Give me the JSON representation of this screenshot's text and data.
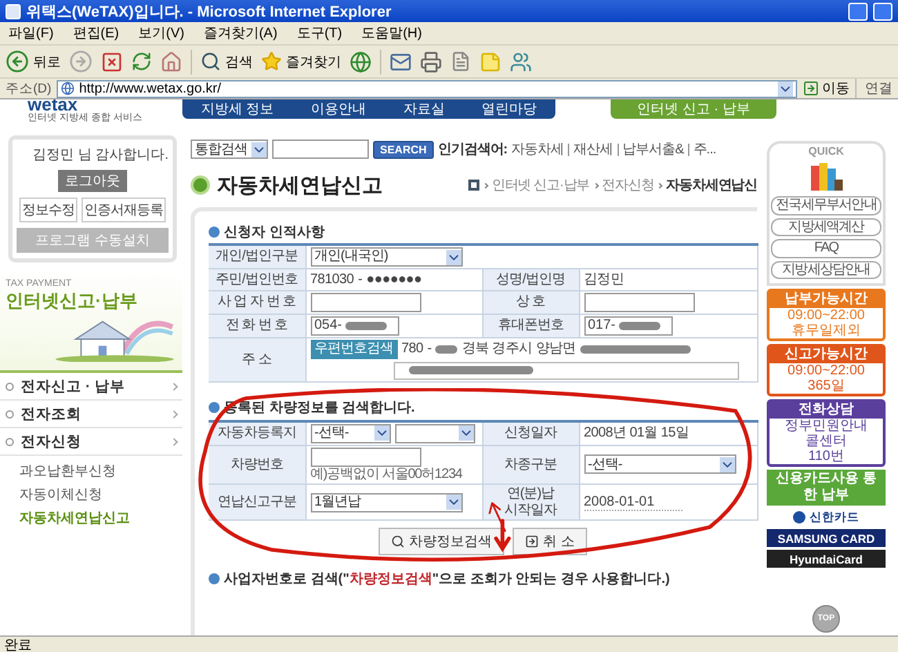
{
  "window": {
    "title": "위택스(WeTAX)입니다. - Microsoft Internet Explorer"
  },
  "menu": [
    "파일(F)",
    "편집(E)",
    "보기(V)",
    "즐겨찾기(A)",
    "도구(T)",
    "도움말(H)"
  ],
  "toolbar": {
    "back": "뒤로",
    "search": "검색",
    "favorites": "즐겨찾기"
  },
  "address_bar": {
    "label": "주소(D)",
    "url": "http://www.wetax.go.kr/",
    "go": "이동",
    "links": "연결"
  },
  "site_header": {
    "logo": "wetax",
    "tagline": "인터넷 지방세 종합 서비스",
    "nav": [
      {
        "label": "지방세 정보",
        "selected": false
      },
      {
        "label": "이용안내",
        "selected": false
      },
      {
        "label": "자료실",
        "selected": false
      },
      {
        "label": "열린마당",
        "selected": false
      },
      {
        "label": "인터넷 신고 · 납부",
        "selected": true
      }
    ]
  },
  "login": {
    "greeting": "김정민 님 감사합니다.",
    "logout": "로그아웃",
    "buttons": [
      "정보수정",
      "인증서재등록"
    ],
    "install": "프로그램 수동설치"
  },
  "banner": {
    "caption": "TAX PAYMENT",
    "title": "인터넷신고·납부"
  },
  "sidebar": {
    "items": [
      {
        "label": "전자신고 · 납부"
      },
      {
        "label": "전자조회"
      },
      {
        "label": "전자신청",
        "children": [
          {
            "label": "과오납환부신청",
            "selected": false
          },
          {
            "label": "자동이체신청",
            "selected": false
          },
          {
            "label": "자동차세연납신고",
            "selected": true
          }
        ]
      }
    ]
  },
  "search": {
    "scope": "통합검색",
    "button": "SEARCH",
    "popular_label": "인기검색어:",
    "popular": [
      "자동차세",
      "재산세",
      "납부서출&",
      "주..."
    ]
  },
  "page": {
    "title": "자동차세연납신고",
    "breadcrumb": [
      "인터넷 신고·납부",
      "전자신청",
      "자동차세연납신"
    ]
  },
  "applicant": {
    "heading": "신청자 인적사항",
    "rows": [
      [
        {
          "kind": "label",
          "text": "개인/법인구분"
        },
        {
          "kind": "select",
          "value": "개인(내국인)",
          "colspan": 3
        }
      ],
      [
        {
          "kind": "label",
          "text": "주민/법인번호"
        },
        {
          "kind": "id",
          "value": "781030",
          "separator": "-",
          "hidden": "●●●●●●●"
        },
        {
          "kind": "label",
          "text": "성명/법인명"
        },
        {
          "kind": "text",
          "value": "김정민"
        }
      ],
      [
        {
          "kind": "label",
          "text": "사 업 자 번 호"
        },
        {
          "kind": "input"
        },
        {
          "kind": "label",
          "text": "상 호"
        },
        {
          "kind": "input"
        }
      ],
      [
        {
          "kind": "label",
          "text": "전 화 번 호"
        },
        {
          "kind": "phone",
          "value": "054-"
        },
        {
          "kind": "label",
          "text": "휴대폰번호"
        },
        {
          "kind": "phone",
          "value": "017-"
        }
      ],
      [
        {
          "kind": "label",
          "text": "주 소"
        },
        {
          "kind": "address",
          "button": "우편번호검색",
          "zip": "780",
          "separator": "-",
          "city": "경북 경주시 양남면",
          "colspan": 3
        }
      ]
    ]
  },
  "vehicle": {
    "heading": "등록된 차량정보를 검색합니다.",
    "rows": [
      [
        {
          "kind": "label",
          "text": "자동차등록지"
        },
        {
          "kind": "select_pair",
          "value": "-선택-"
        },
        {
          "kind": "label",
          "text": "신청일자"
        },
        {
          "kind": "text",
          "value": "2008년 01월 15일"
        }
      ],
      [
        {
          "kind": "label",
          "text": "차량번호"
        },
        {
          "kind": "input",
          "note": "예)공백없이 서울00허1234"
        },
        {
          "kind": "label",
          "text": "차종구분"
        },
        {
          "kind": "select",
          "value": "-선택-"
        }
      ],
      [
        {
          "kind": "label",
          "text": "연납신고구분"
        },
        {
          "kind": "select",
          "value": "1월년납"
        },
        {
          "kind": "label",
          "text": "연(분)납 시작일자"
        },
        {
          "kind": "date",
          "value": "2008-01-01"
        }
      ]
    ],
    "buttons": [
      {
        "kind": "search",
        "label": "차량정보검색"
      },
      {
        "kind": "cancel",
        "label": "취 소"
      }
    ]
  },
  "business_search": {
    "heading": "사업자번호로 검색(\"**차량정보검색**\"으로 조회가 안되는 경우 사용합니다.)"
  },
  "quick": {
    "title": "QUICK",
    "links": [
      "전국세무부서안내",
      "지방세액계산",
      "FAQ",
      "지방세상담안내"
    ],
    "notices": [
      {
        "title": "납부가능시간",
        "lines": [
          "09:00~22:00",
          "휴무일제외"
        ],
        "color": "#e8781e"
      },
      {
        "title": "신고가능시간",
        "lines": [
          "09:00~22:00",
          "365일"
        ],
        "color": "#e0561a"
      },
      {
        "title": "전화상담",
        "lines": [
          "정부민원안내",
          "콜센터",
          "110번"
        ],
        "color": "#5b3f9c"
      }
    ],
    "card_banner": "신용카드사용 통한 납부",
    "cards": [
      "신한카드",
      "SAMSUNG CARD",
      "HyundaiCard"
    ],
    "top": "TOP"
  },
  "status_bar": {
    "text": "완료"
  }
}
